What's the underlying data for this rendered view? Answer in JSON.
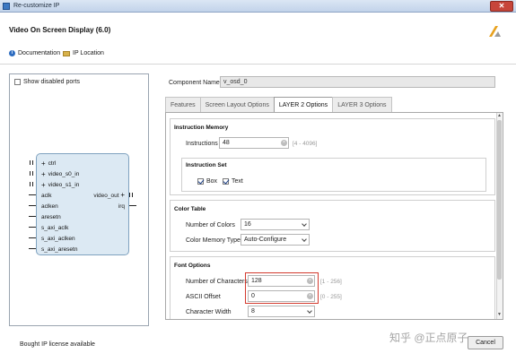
{
  "window": {
    "title": "Re-customize IP",
    "close_label": "✕"
  },
  "header": {
    "title": "Video On Screen Display (6.0)"
  },
  "toolbar": {
    "documentation": "Documentation",
    "ip_location": "IP Location"
  },
  "left_panel": {
    "show_disabled_ports": "Show disabled ports",
    "ports_in": [
      "ctrl",
      "video_s0_in",
      "video_s1_in",
      "aclk",
      "aclken",
      "aresetn",
      "s_axi_aclk",
      "s_axi_aclken",
      "s_axi_aresetn"
    ],
    "ports_out": [
      "video_out",
      "irq"
    ]
  },
  "component": {
    "label": "Component Name",
    "value": "v_osd_0"
  },
  "tabs": [
    "Features",
    "Screen Layout Options",
    "LAYER 2 Options",
    "LAYER 3 Options"
  ],
  "instruction_memory": {
    "title": "Instruction Memory",
    "instructions_label": "Instructions",
    "instructions_value": "48",
    "instructions_range": "[4 - 4096]",
    "instruction_set_title": "Instruction Set",
    "box_label": "Box",
    "text_label": "Text"
  },
  "color_table": {
    "title": "Color Table",
    "num_colors_label": "Number of Colors",
    "num_colors_value": "16",
    "color_memory_label": "Color Memory Type",
    "color_memory_value": "Auto-Configure"
  },
  "font_options": {
    "title": "Font Options",
    "num_chars_label": "Number of Characters",
    "num_chars_value": "128",
    "num_chars_range": "[1 - 256]",
    "ascii_label": "ASCII Offset",
    "ascii_value": "0",
    "ascii_range": "[0 - 255]",
    "char_width_label": "Character Width",
    "char_width_value": "8"
  },
  "status": "Bought IP license available",
  "watermark": "知乎 @正点原子",
  "cancel_label": "Cancel",
  "colors": {
    "highlight": "#d33a2f",
    "ip_block": "#dce9f3",
    "titlebar": "#c2d3ea"
  }
}
